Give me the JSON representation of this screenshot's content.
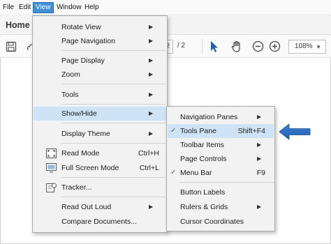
{
  "menubar": {
    "items": [
      {
        "label": "File"
      },
      {
        "label": "Edit"
      },
      {
        "label": "View"
      },
      {
        "label": "Window"
      },
      {
        "label": "Help"
      }
    ]
  },
  "tab": {
    "home_label": "Home"
  },
  "toolbar": {
    "page_current": "2",
    "page_total": "/ 2",
    "zoom": "108%",
    "icons": [
      "save-icon",
      "cloud-icon",
      "select-arrow-icon",
      "hand-icon",
      "zoom-out-icon",
      "zoom-in-icon"
    ]
  },
  "view_menu": {
    "items": [
      {
        "label": "Rotate View",
        "submenu": true
      },
      {
        "label": "Page Navigation",
        "submenu": true
      },
      {
        "label": "Page Display",
        "submenu": true
      },
      {
        "label": "Zoom",
        "submenu": true
      },
      {
        "label": "Tools",
        "submenu": true
      },
      {
        "label": "Show/Hide",
        "submenu": true
      },
      {
        "label": "Display Theme",
        "submenu": true
      },
      {
        "label": "Read Mode",
        "shortcut": "Ctrl+H",
        "icon": "read-mode-icon"
      },
      {
        "label": "Full Screen Mode",
        "shortcut": "Ctrl+L",
        "icon": "full-screen-icon"
      },
      {
        "label": "Tracker...",
        "icon": "tracker-icon"
      },
      {
        "label": "Read Out Loud",
        "submenu": true
      },
      {
        "label": "Compare Documents..."
      }
    ]
  },
  "showhide_menu": {
    "items": [
      {
        "label": "Navigation Panes",
        "submenu": true
      },
      {
        "label": "Tools Pane",
        "shortcut": "Shift+F4",
        "checked": true
      },
      {
        "label": "Toolbar Items",
        "submenu": true
      },
      {
        "label": "Page Controls",
        "submenu": true
      },
      {
        "label": "Menu Bar",
        "shortcut": "F9",
        "checked": true
      },
      {
        "label": "Button Labels"
      },
      {
        "label": "Rulers & Grids",
        "submenu": true
      },
      {
        "label": "Cursor Coordinates"
      }
    ]
  },
  "glyphs": {
    "submenu_arrow": "▶",
    "check": "✓",
    "dropdown": "▼"
  },
  "colors": {
    "menu_highlight": "#cfe3f6",
    "active_menu": "#3f8fd6",
    "callout_arrow": "#1f5fae"
  }
}
